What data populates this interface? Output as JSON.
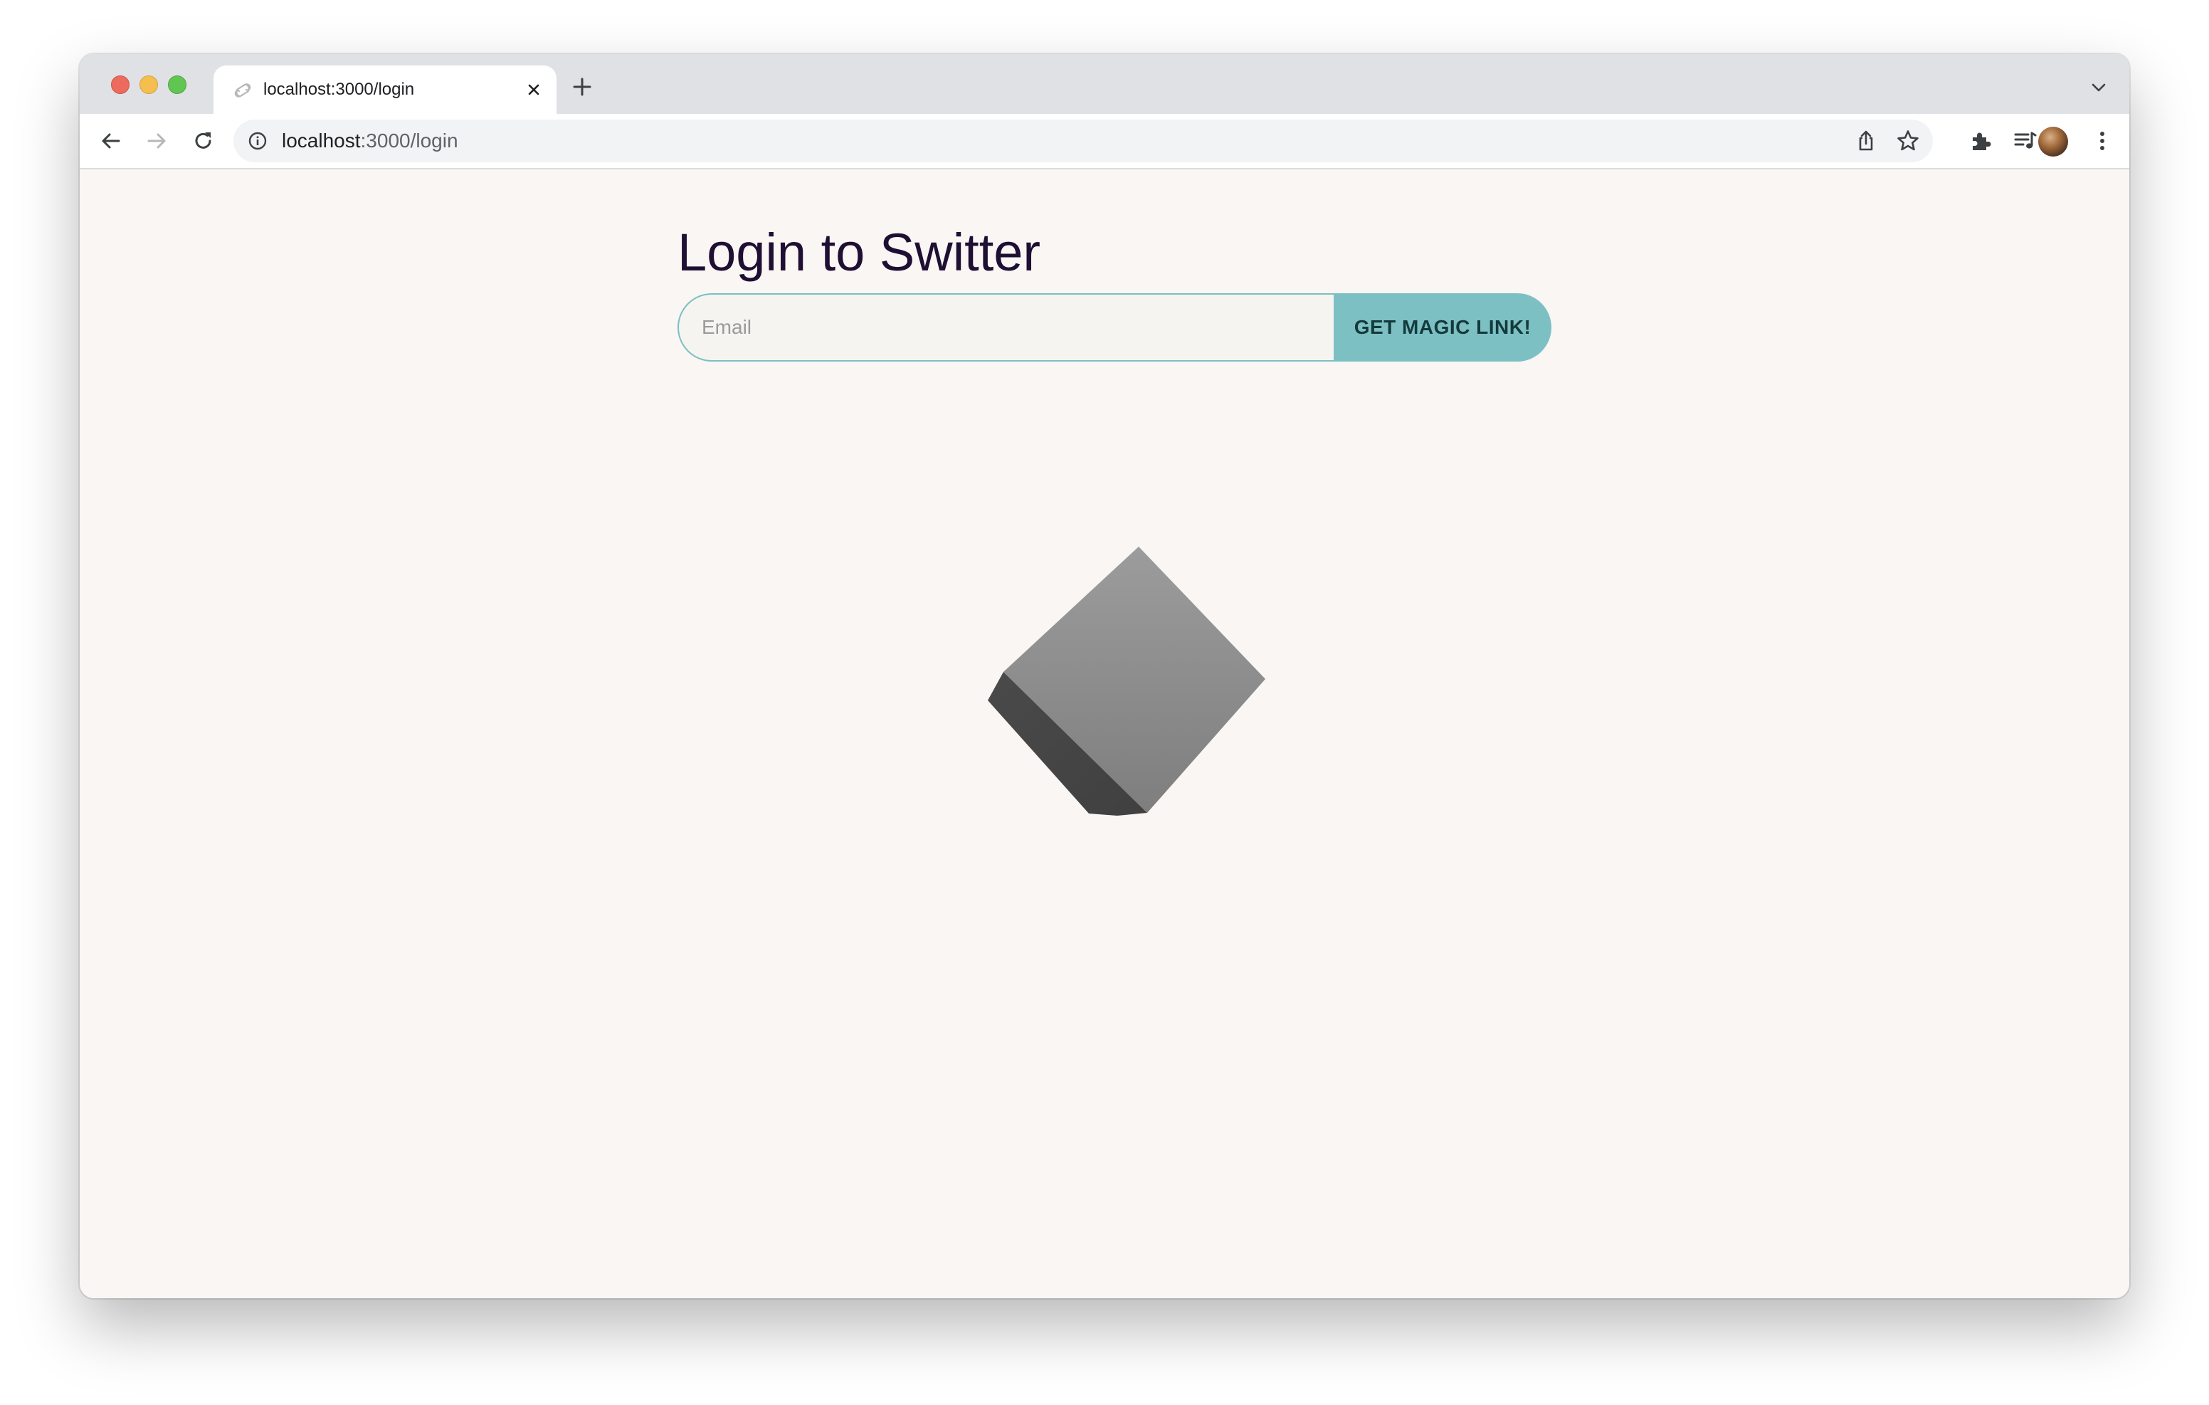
{
  "browser": {
    "tab": {
      "title": "localhost:3000/login",
      "favicon": "svelte-logo-icon"
    },
    "address_bar": {
      "host": "localhost",
      "path": ":3000/login"
    },
    "colors": {
      "tabstrip": "#dfe1e5",
      "toolbar": "#ffffff",
      "omnibox": "#f1f3f4"
    }
  },
  "page": {
    "title": "Login to Switter",
    "email": {
      "placeholder": "Email",
      "value": ""
    },
    "submit_label": "GET MAGIC LINK!",
    "colors": {
      "background": "#f9f6f3",
      "title": "#1e0f33",
      "accent": "#7cc0c4",
      "button_text": "#143a3c"
    },
    "illustration": "gray-3d-cube"
  }
}
